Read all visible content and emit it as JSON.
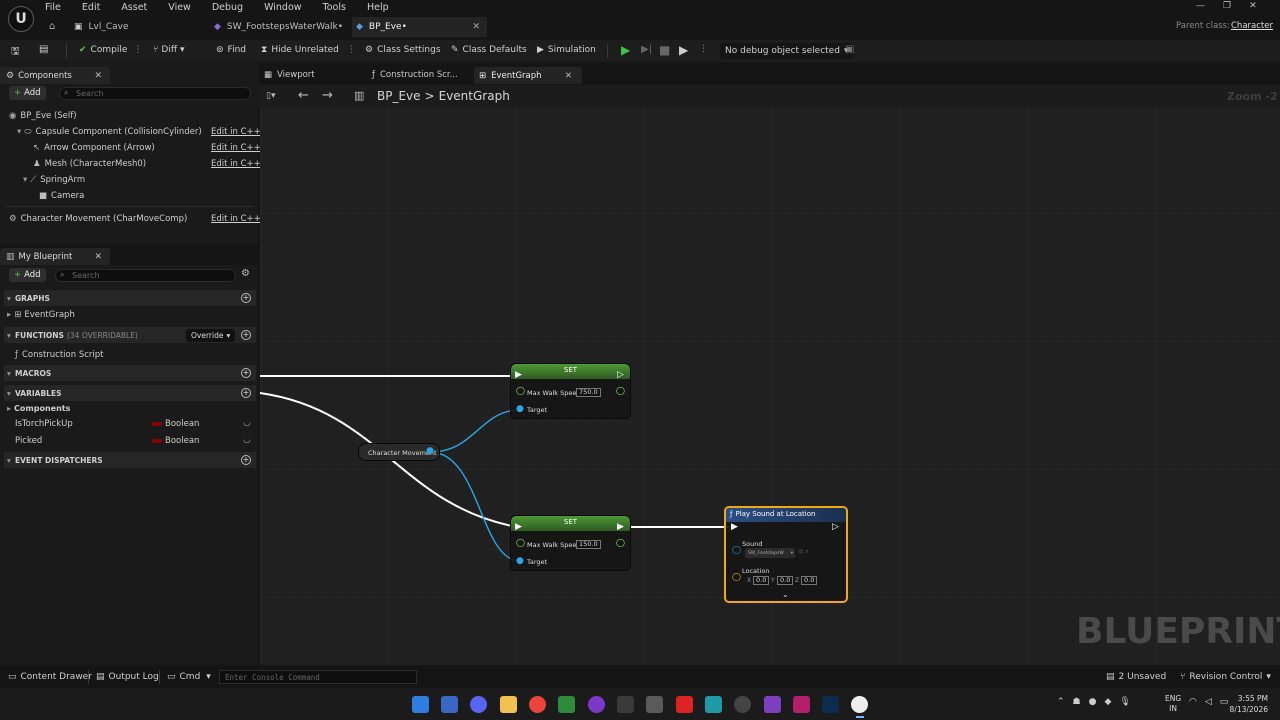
{
  "menu": [
    "File",
    "Edit",
    "Asset",
    "View",
    "Debug",
    "Window",
    "Tools",
    "Help"
  ],
  "tabs": [
    {
      "label": "Lvl_Cave"
    },
    {
      "label": "SW_FootstepsWaterWalk•"
    },
    {
      "label": "BP_Eve•"
    }
  ],
  "parent_class": {
    "label": "Parent class:",
    "value": "Character"
  },
  "toolbar": {
    "compile": "Compile",
    "diff": "Diff",
    "find": "Find",
    "hide_unrelated": "Hide Unrelated",
    "class_settings": "Class Settings",
    "class_defaults": "Class Defaults",
    "simulation": "Simulation",
    "debug_object": "No debug object selected"
  },
  "components_panel": {
    "title": "Components",
    "add": "Add",
    "search_placeholder": "Search",
    "items": [
      {
        "label": "BP_Eve (Self)",
        "edit": ""
      },
      {
        "label": "Capsule Component (CollisionCylinder)",
        "edit": "Edit in C++"
      },
      {
        "label": "Arrow Component (Arrow)",
        "edit": "Edit in C++"
      },
      {
        "label": "Mesh (CharacterMesh0)",
        "edit": "Edit in C++"
      },
      {
        "label": "SpringArm",
        "edit": ""
      },
      {
        "label": "Camera",
        "edit": ""
      },
      {
        "label": "Character Movement (CharMoveComp)",
        "edit": "Edit in C++"
      }
    ]
  },
  "my_blueprint": {
    "title": "My Blueprint",
    "add": "Add",
    "search_placeholder": "Search",
    "graphs": "GRAPHS",
    "event_graph": "EventGraph",
    "functions": "FUNCTIONS",
    "functions_count": "(34 OVERRIDABLE)",
    "override": "Override",
    "construction_script": "Construction Script",
    "macros": "MACROS",
    "variables": "VARIABLES",
    "components": "Components",
    "vars": [
      {
        "name": "IsTorchPickUp",
        "type": "Boolean"
      },
      {
        "name": "Picked",
        "type": "Boolean"
      }
    ],
    "event_dispatchers": "EVENT DISPATCHERS"
  },
  "editor_tabs": [
    "Viewport",
    "Construction Scr...",
    "EventGraph"
  ],
  "breadcrumb": {
    "root": "BP_Eve",
    "sep": ">",
    "current": "EventGraph"
  },
  "zoom": "Zoom -2",
  "watermark": "BLUEPRINT",
  "nodes": {
    "set_top": {
      "title": "SET",
      "pin": "Max Walk Speed",
      "value": "750.0",
      "target": "Target"
    },
    "char_movement": {
      "title": "Character Movement"
    },
    "set_bottom": {
      "title": "SET",
      "pin": "Max Walk Speed",
      "value": "150.0",
      "target": "Target"
    },
    "play_sound": {
      "title": "Play Sound at Location",
      "sound": "Sound",
      "sound_value": "SW_FootstepsW",
      "location": "Location",
      "x": "0.0",
      "y": "0.0",
      "z": "0.0"
    }
  },
  "statusbar": {
    "content_drawer": "Content Drawer",
    "output_log": "Output Log",
    "cmd": "Cmd",
    "console_placeholder": "Enter Console Command",
    "unsaved": "2 Unsaved",
    "revision_control": "Revision Control"
  },
  "taskbar": {
    "lang1": "ENG",
    "lang2": "IN",
    "time": "3:55 PM",
    "date": "8/13/2026"
  },
  "colors": {
    "exec": "#ffffff",
    "float": "#9bff6a",
    "object": "#28a6e8",
    "bool": "#8e0000",
    "set_header": "#3b7d2a",
    "sound_header": "#1f3c66",
    "selected": "#f2a816"
  }
}
